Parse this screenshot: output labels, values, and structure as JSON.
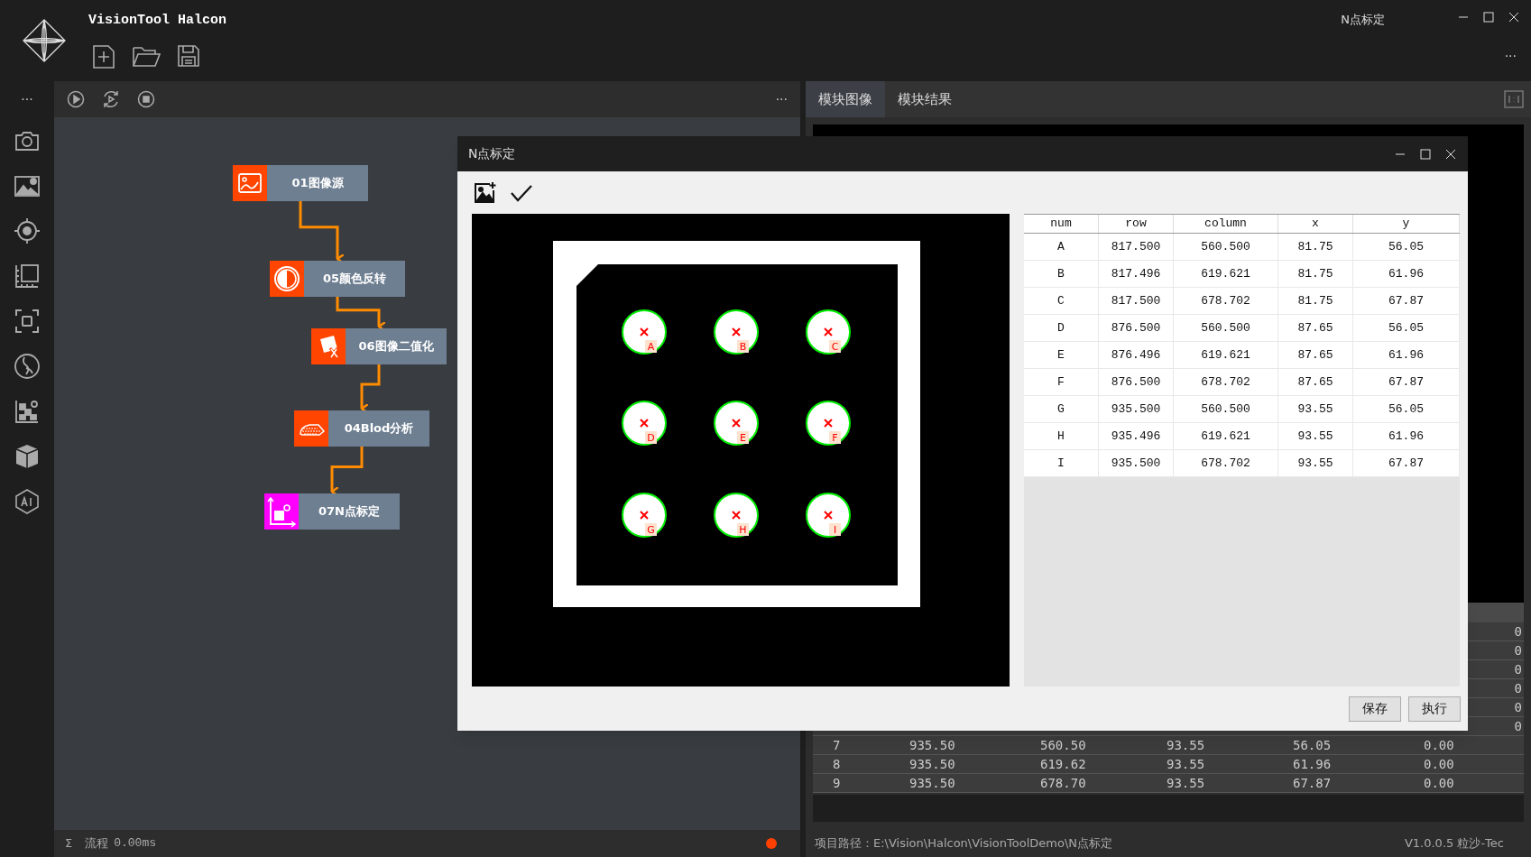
{
  "app": {
    "title": "VisionTool Halcon",
    "module_name": "N点标定",
    "more": "···"
  },
  "sidebar": {
    "more": "···"
  },
  "flow": {
    "more": "···",
    "nodes": [
      {
        "label": "01图像源",
        "kind": "image",
        "color": "#ff4500"
      },
      {
        "label": "05颜色反转",
        "kind": "invert",
        "color": "#ff4500"
      },
      {
        "label": "06图像二值化",
        "kind": "binary",
        "color": "#ff4500"
      },
      {
        "label": "04Blod分析",
        "kind": "blob",
        "color": "#ff4500"
      },
      {
        "label": "07N点标定",
        "kind": "calib",
        "color": "#ff00ff"
      }
    ],
    "status": {
      "sigma": "Σ",
      "label": "流程",
      "time": "0.00ms"
    }
  },
  "result_panel": {
    "tabs": [
      {
        "label": "模块图像",
        "selected": true
      },
      {
        "label": "模块结果",
        "selected": false
      }
    ],
    "covered_rows": [
      {
        "tail": "0"
      },
      {
        "tail": "0"
      },
      {
        "tail": "0"
      },
      {
        "tail": "0"
      },
      {
        "tail": "0"
      },
      {
        "tail": "0"
      }
    ],
    "rows": [
      [
        "7",
        "935.50",
        "560.50",
        "93.55",
        "56.05",
        "0.00"
      ],
      [
        "8",
        "935.50",
        "619.62",
        "93.55",
        "61.96",
        "0.00"
      ],
      [
        "9",
        "935.50",
        "678.70",
        "93.55",
        "67.87",
        "0.00"
      ]
    ],
    "path": "项目路径：E:\\Vision\\Halcon\\VisionToolDemo\\N点标定",
    "version": "V1.0.0.5 粒沙-Tec"
  },
  "dialog": {
    "title": "N点标定",
    "points": [
      "A",
      "B",
      "C",
      "D",
      "E",
      "F",
      "G",
      "H",
      "I"
    ],
    "table": {
      "columns": [
        "num",
        "row",
        "column",
        "x",
        "y"
      ],
      "rows": [
        [
          "A",
          "817.500",
          "560.500",
          "81.75",
          "56.05"
        ],
        [
          "B",
          "817.496",
          "619.621",
          "81.75",
          "61.96"
        ],
        [
          "C",
          "817.500",
          "678.702",
          "81.75",
          "67.87"
        ],
        [
          "D",
          "876.500",
          "560.500",
          "87.65",
          "56.05"
        ],
        [
          "E",
          "876.496",
          "619.621",
          "87.65",
          "61.96"
        ],
        [
          "F",
          "876.500",
          "678.702",
          "87.65",
          "67.87"
        ],
        [
          "G",
          "935.500",
          "560.500",
          "93.55",
          "56.05"
        ],
        [
          "H",
          "935.496",
          "619.621",
          "93.55",
          "61.96"
        ],
        [
          "I",
          "935.500",
          "678.702",
          "93.55",
          "67.87"
        ]
      ]
    },
    "buttons": [
      "保存",
      "执行"
    ]
  }
}
